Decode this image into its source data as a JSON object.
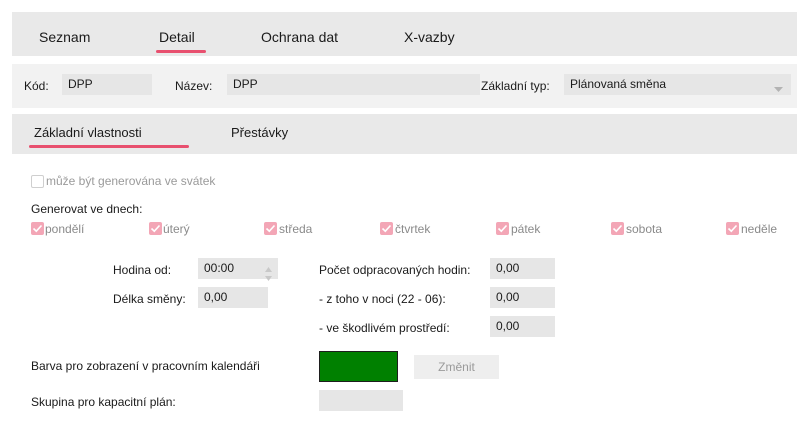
{
  "top_tabs": [
    {
      "label": "Seznam",
      "active": false
    },
    {
      "label": "Detail",
      "active": true
    },
    {
      "label": "Ochrana dat",
      "active": false
    },
    {
      "label": "X-vazby",
      "active": false
    }
  ],
  "header": {
    "code_label": "Kód:",
    "code_value": "DPP",
    "name_label": "Název:",
    "name_value": "DPP",
    "type_label": "Základní typ:",
    "type_value": "Plánovaná směna"
  },
  "sub_tabs": [
    {
      "label": "Základní vlastnosti",
      "active": true
    },
    {
      "label": "Přestávky",
      "active": false
    }
  ],
  "holiday_checkbox": {
    "label": "může být generována ve svátek",
    "checked": false,
    "disabled": true
  },
  "generate_days": {
    "label": "Generovat ve dnech:",
    "days": [
      {
        "label": "pondělí",
        "checked": true
      },
      {
        "label": "úterý",
        "checked": true
      },
      {
        "label": "středa",
        "checked": true
      },
      {
        "label": "čtvrtek",
        "checked": true
      },
      {
        "label": "pátek",
        "checked": true
      },
      {
        "label": "sobota",
        "checked": true
      },
      {
        "label": "neděle",
        "checked": true
      }
    ]
  },
  "times": {
    "start_label": "Hodina od:",
    "start_value": "00:00",
    "length_label": "Délka směny:",
    "length_value": "0,00"
  },
  "hours": {
    "worked_label": "Počet odpracovaných hodin:",
    "worked_value": "0,00",
    "night_label": "- z toho v noci (22 - 06):",
    "night_value": "0,00",
    "harmful_label": "- ve škodlivém prostředí:",
    "harmful_value": "0,00"
  },
  "calendar_color": {
    "label": "Barva pro zobrazení v pracovním kalendáři",
    "color": "#008000",
    "button_label": "Změnit"
  },
  "capacity_group": {
    "label": "Skupina pro kapacitní plán:",
    "value": ""
  },
  "colors": {
    "accent": "#e8506f",
    "checkbox_checked": "#f3a6b6",
    "field_bg": "#e6e6e6"
  }
}
